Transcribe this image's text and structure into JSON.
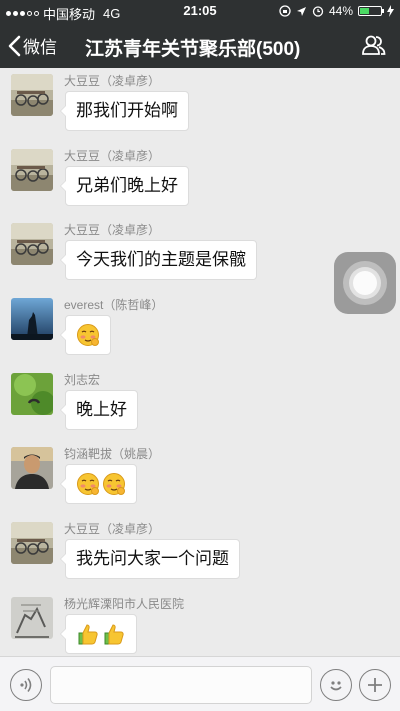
{
  "status_bar": {
    "carrier": "中国移动",
    "network": "4G",
    "time": "21:05",
    "battery_percent": "44%",
    "battery_level": 0.44
  },
  "nav": {
    "back_label": "微信",
    "title": "江苏青年关节聚乐部(500)",
    "people_icon": "group-people-icon"
  },
  "messages": [
    {
      "sender": "大豆豆（凌卓彦）",
      "text": "那我们开始啊",
      "avatar": "bicycles-photo"
    },
    {
      "sender": "大豆豆（凌卓彦）",
      "text": "兄弟们晚上好",
      "avatar": "bicycles-photo"
    },
    {
      "sender": "大豆豆（凌卓彦）",
      "text": "今天我们的主题是保髋",
      "avatar": "bicycles-photo"
    },
    {
      "sender": "everest（陈哲峰）",
      "text": "",
      "emojis": [
        "blush-emoji"
      ],
      "avatar": "wolf-silhouette"
    },
    {
      "sender": "刘志宏",
      "text": "晚上好",
      "avatar": "green-nature-photo"
    },
    {
      "sender": "钧涵靶拔（姚晨）",
      "text": "",
      "emojis": [
        "blush-emoji",
        "blush-emoji"
      ],
      "avatar": "man-portrait"
    },
    {
      "sender": "大豆豆（凌卓彦）",
      "text": "我先问大家一个问题",
      "avatar": "bicycles-photo"
    },
    {
      "sender": "杨光辉溧阳市人民医院",
      "text": "",
      "emojis": [
        "thumbs-up-emoji",
        "thumbs-up-emoji"
      ],
      "avatar": "sketch-figure"
    }
  ],
  "input_bar": {
    "voice_icon": "voice-icon",
    "text_value": "",
    "emoji_icon": "smiley-icon",
    "plus_icon": "plus-icon"
  },
  "colors": {
    "header_bg": "#2e3132",
    "chat_bg": "#ebebeb",
    "bubble_bg": "#ffffff",
    "battery_green": "#4cd964"
  }
}
